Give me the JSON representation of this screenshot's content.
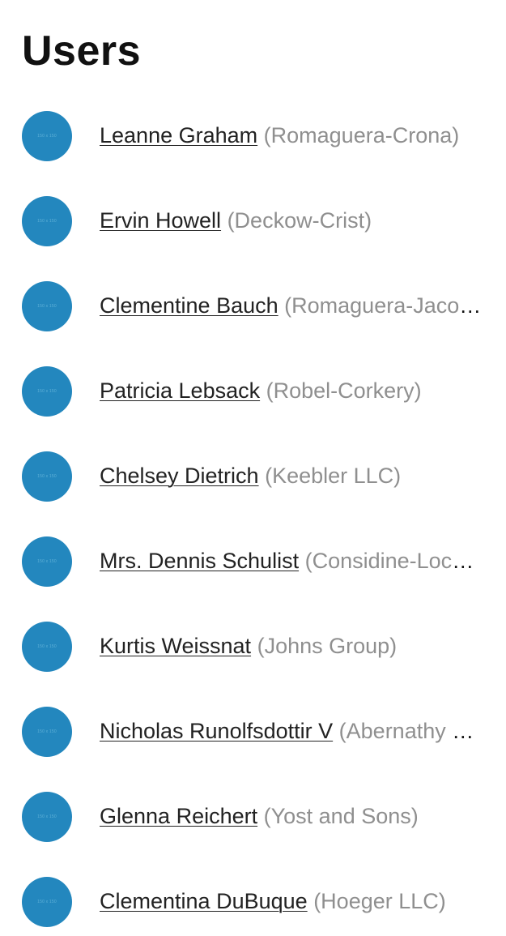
{
  "page": {
    "title": "Users"
  },
  "avatar_placeholder_text": "150 x 150",
  "colors": {
    "avatar": "#2387be",
    "company_text": "#8f8f8f",
    "name_text": "#222222"
  },
  "users": [
    {
      "name": "Leanne Graham",
      "company": "(Romaguera-Crona)"
    },
    {
      "name": "Ervin Howell",
      "company": "(Deckow-Crist)"
    },
    {
      "name": "Clementine Bauch",
      "company": "(Romaguera-Jacobson)"
    },
    {
      "name": "Patricia Lebsack",
      "company": "(Robel-Corkery)"
    },
    {
      "name": "Chelsey Dietrich",
      "company": "(Keebler LLC)"
    },
    {
      "name": "Mrs. Dennis Schulist",
      "company": "(Considine-Lockman)"
    },
    {
      "name": "Kurtis Weissnat",
      "company": "(Johns Group)"
    },
    {
      "name": "Nicholas Runolfsdottir V",
      "company": "(Abernathy Group)"
    },
    {
      "name": "Glenna Reichert",
      "company": "(Yost and Sons)"
    },
    {
      "name": "Clementina DuBuque",
      "company": "(Hoeger LLC)"
    }
  ]
}
